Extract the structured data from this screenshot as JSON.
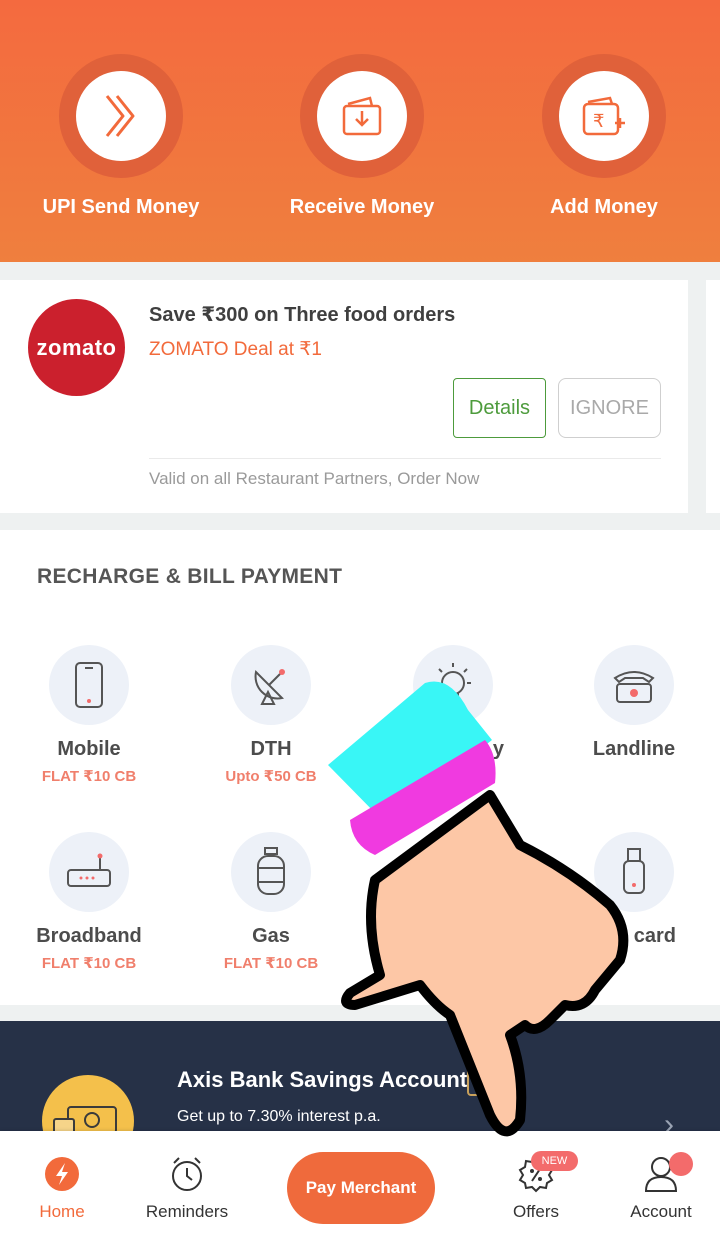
{
  "quick_actions": [
    {
      "label": "UPI Send Money",
      "icon": "upi-send-icon"
    },
    {
      "label": "Receive Money",
      "icon": "receive-money-icon"
    },
    {
      "label": "Add Money",
      "icon": "wallet-add-icon"
    }
  ],
  "offer": {
    "brand": "zomato",
    "title": "Save ₹300 on Three food orders",
    "subtitle": "ZOMATO Deal at ₹1",
    "details_label": "Details",
    "ignore_label": "IGNORE",
    "note": "Valid on all Restaurant Partners, Order Now"
  },
  "recharge": {
    "title": "RECHARGE & BILL PAYMENT",
    "tiles": [
      {
        "name": "Mobile",
        "cashback": "FLAT ₹10 CB",
        "icon": "mobile-icon"
      },
      {
        "name": "DTH",
        "cashback": "Upto ₹50 CB",
        "icon": "satellite-dish-icon"
      },
      {
        "name": "y",
        "cashback": "",
        "icon": "bulb-icon"
      },
      {
        "name": "Landline",
        "cashback": "",
        "icon": "telephone-icon"
      },
      {
        "name": "Broadband",
        "cashback": "FLAT ₹10 CB",
        "icon": "router-icon"
      },
      {
        "name": "Gas",
        "cashback": "FLAT ₹10 CB",
        "icon": "gas-cylinder-icon"
      },
      {
        "name": "card",
        "cashback": "",
        "icon": "datacard-icon"
      }
    ]
  },
  "axis": {
    "title": "Axis Bank Savings Account",
    "subtitle": "Get up to 7.30% interest p.a."
  },
  "nav": {
    "home": "Home",
    "reminders": "Reminders",
    "pay_merchant": "Pay Merchant",
    "offers": "Offers",
    "offers_badge": "NEW",
    "account": "Account"
  },
  "colors": {
    "brand_orange": "#f26a3b",
    "zomato_red": "#cb202d",
    "details_green": "#4d9b3c",
    "banner_navy": "#263147"
  }
}
